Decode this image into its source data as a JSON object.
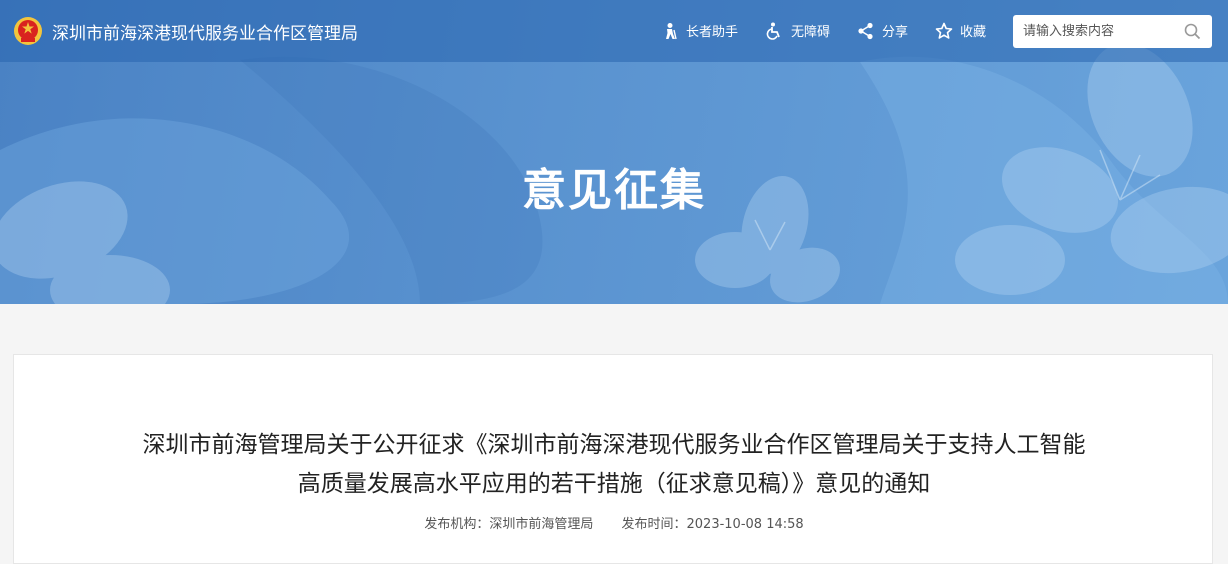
{
  "header": {
    "site_title": "深圳市前海深港现代服务业合作区管理局",
    "tools": [
      {
        "label": "长者助手",
        "icon": "elder-assist-icon"
      },
      {
        "label": "无障碍",
        "icon": "accessibility-icon"
      },
      {
        "label": "分享",
        "icon": "share-icon"
      },
      {
        "label": "收藏",
        "icon": "star-icon"
      }
    ],
    "search": {
      "placeholder": "请输入搜索内容",
      "value": ""
    }
  },
  "banner": {
    "title": "意见征集"
  },
  "article": {
    "title_line1": "深圳市前海管理局关于公开征求《深圳市前海深港现代服务业合作区管理局关于支持人工智能",
    "title_line2": "高质量发展高水平应用的若干措施（征求意见稿）》意见的通知",
    "publisher_label": "发布机构：",
    "publisher": "深圳市前海管理局",
    "time_label": "发布时间：",
    "time": "2023-10-08 14:58"
  },
  "colors": {
    "banner": "#5a93d0",
    "topbar": "#3f7bc0",
    "card": "#ffffff",
    "emblem_red": "#d9231f",
    "emblem_gold": "#f3c53c"
  }
}
